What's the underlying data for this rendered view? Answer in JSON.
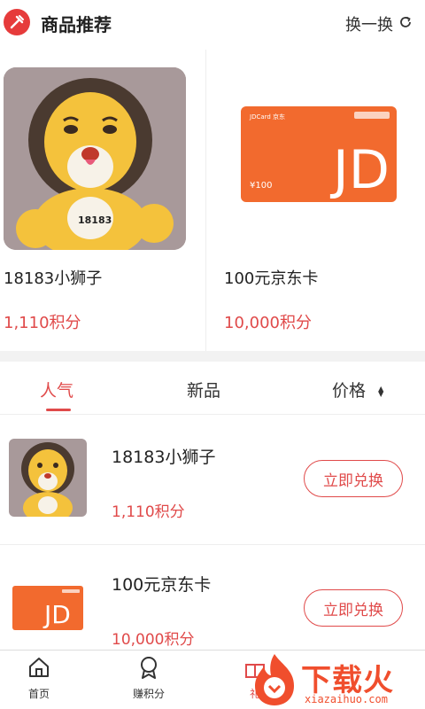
{
  "header": {
    "title": "商品推荐",
    "refresh_label": "换一换"
  },
  "recommend": [
    {
      "name": "18183小狮子",
      "points": "1,110积分"
    },
    {
      "name": "100元京东卡",
      "points": "10,000积分"
    }
  ],
  "jd_card": {
    "logo_text": "JD",
    "amount": "¥100",
    "header_text": "JDCard 京东"
  },
  "tabs": [
    {
      "label": "人气",
      "active": true
    },
    {
      "label": "新品",
      "active": false
    },
    {
      "label": "价格",
      "active": false
    }
  ],
  "list": [
    {
      "name": "18183小狮子",
      "points": "1,110积分",
      "button": "立即兑换"
    },
    {
      "name": "100元京东卡",
      "points": "10,000积分",
      "button": "立即兑换"
    }
  ],
  "bottom_nav": [
    {
      "label": "首页",
      "icon": "home-icon",
      "active": false
    },
    {
      "label": "赚积分",
      "icon": "medal-icon",
      "active": false
    },
    {
      "label": "礼",
      "icon": "gift-icon",
      "active": true
    }
  ],
  "watermark": {
    "brand": "下载火",
    "domain": "xiazaihuo.com"
  },
  "colors": {
    "accent": "#e04a4a",
    "jd_orange": "#f26a2e",
    "watermark": "#f04e2d"
  }
}
